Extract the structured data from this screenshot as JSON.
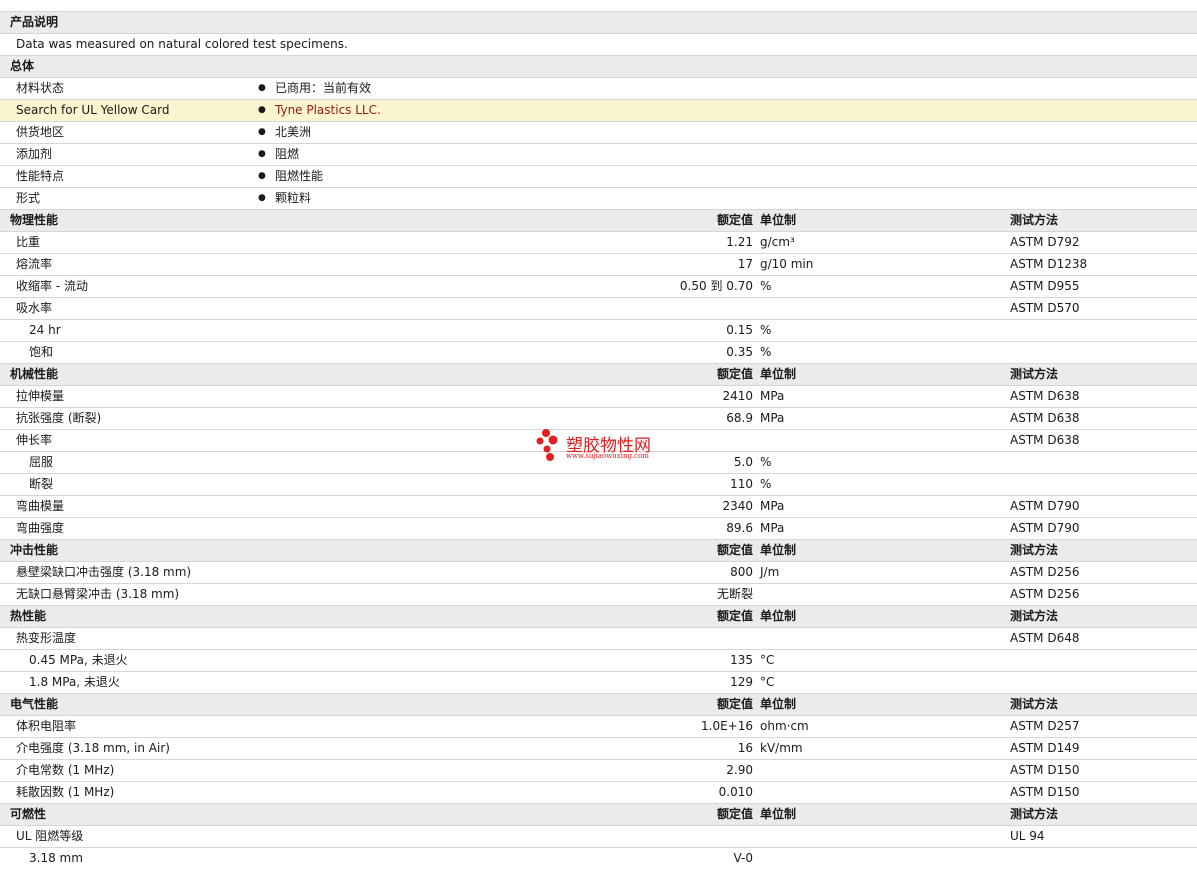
{
  "product_description": {
    "title": "产品说明",
    "text": "Data was measured on natural colored test specimens."
  },
  "general": {
    "title": "总体",
    "rows": [
      {
        "label": "材料状态",
        "value": "已商用：当前有效"
      },
      {
        "label": "Search for UL Yellow Card",
        "value": "Tyne Plastics LLC."
      },
      {
        "label": "供货地区",
        "value": "北美洲"
      },
      {
        "label": "添加剂",
        "value": "阻燃"
      },
      {
        "label": "性能特点",
        "value": "阻燃性能"
      },
      {
        "label": "形式",
        "value": "颗粒料"
      }
    ]
  },
  "column_headers": {
    "value": "额定值",
    "unit": "单位制",
    "method": "测试方法"
  },
  "sections": [
    {
      "title": "物理性能",
      "rows": [
        {
          "label": "比重",
          "value": "1.21",
          "unit": "g/cm³",
          "method": "ASTM D792"
        },
        {
          "label": "熔流率",
          "value": "17",
          "unit": "g/10 min",
          "method": "ASTM D1238"
        },
        {
          "label": "收缩率  - 流动",
          "value": "0.50 到  0.70",
          "unit": "%",
          "method": "ASTM D955"
        },
        {
          "label": "吸水率",
          "value": "",
          "unit": "",
          "method": "ASTM D570"
        },
        {
          "label": "24 hr",
          "value": "0.15",
          "unit": "%",
          "method": "",
          "sub": true
        },
        {
          "label": "饱和",
          "value": "0.35",
          "unit": "%",
          "method": "",
          "sub": true
        }
      ]
    },
    {
      "title": "机械性能",
      "rows": [
        {
          "label": "拉伸模量",
          "value": "2410",
          "unit": "MPa",
          "method": "ASTM D638"
        },
        {
          "label": "抗张强度  (断裂)",
          "value": "68.9",
          "unit": "MPa",
          "method": "ASTM D638"
        },
        {
          "label": "伸长率",
          "value": "",
          "unit": "",
          "method": "ASTM D638"
        },
        {
          "label": "屈服",
          "value": "5.0",
          "unit": "%",
          "method": "",
          "sub": true
        },
        {
          "label": "断裂",
          "value": "110",
          "unit": "%",
          "method": "",
          "sub": true
        },
        {
          "label": "弯曲模量",
          "value": "2340",
          "unit": "MPa",
          "method": "ASTM D790"
        },
        {
          "label": "弯曲强度",
          "value": "89.6",
          "unit": "MPa",
          "method": "ASTM D790"
        }
      ]
    },
    {
      "title": "冲击性能",
      "rows": [
        {
          "label": "悬壁梁缺口冲击强度  (3.18 mm)",
          "value": "800",
          "unit": "J/m",
          "method": "ASTM D256"
        },
        {
          "label": "无缺口悬臂梁冲击  (3.18 mm)",
          "value": "无断裂",
          "unit": "",
          "method": "ASTM D256"
        }
      ]
    },
    {
      "title": "热性能",
      "rows": [
        {
          "label": "热变形温度",
          "value": "",
          "unit": "",
          "method": "ASTM D648"
        },
        {
          "label": "0.45 MPa, 未退火",
          "value": "135",
          "unit": "°C",
          "method": "",
          "sub": true
        },
        {
          "label": "1.8 MPa, 未退火",
          "value": "129",
          "unit": "°C",
          "method": "",
          "sub": true
        }
      ]
    },
    {
      "title": "电气性能",
      "rows": [
        {
          "label": "体积电阻率",
          "value": "1.0E+16",
          "unit": "ohm·cm",
          "method": "ASTM D257"
        },
        {
          "label": "介电强度  (3.18 mm, in Air)",
          "value": "16",
          "unit": "kV/mm",
          "method": "ASTM D149"
        },
        {
          "label": "介电常数  (1 MHz)",
          "value": "2.90",
          "unit": "",
          "method": "ASTM D150"
        },
        {
          "label": "耗散因数  (1 MHz)",
          "value": "0.010",
          "unit": "",
          "method": "ASTM D150"
        }
      ]
    },
    {
      "title": "可燃性",
      "rows": [
        {
          "label": "UL 阻燃等级",
          "value": "",
          "unit": "",
          "method": "UL 94"
        },
        {
          "label": "3.18 mm",
          "value": "V-0",
          "unit": "",
          "method": "",
          "sub": true
        }
      ]
    }
  ],
  "watermark": {
    "title": "塑胶物性网",
    "url": "www.sujiaowuxing.com"
  }
}
